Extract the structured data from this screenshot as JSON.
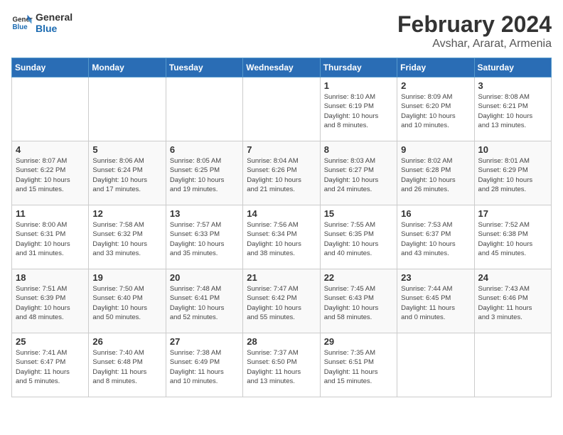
{
  "header": {
    "logo_line1": "General",
    "logo_line2": "Blue",
    "month": "February 2024",
    "location": "Avshar, Ararat, Armenia"
  },
  "days_of_week": [
    "Sunday",
    "Monday",
    "Tuesday",
    "Wednesday",
    "Thursday",
    "Friday",
    "Saturday"
  ],
  "weeks": [
    [
      {
        "day": "",
        "info": ""
      },
      {
        "day": "",
        "info": ""
      },
      {
        "day": "",
        "info": ""
      },
      {
        "day": "",
        "info": ""
      },
      {
        "day": "1",
        "info": "Sunrise: 8:10 AM\nSunset: 6:19 PM\nDaylight: 10 hours\nand 8 minutes."
      },
      {
        "day": "2",
        "info": "Sunrise: 8:09 AM\nSunset: 6:20 PM\nDaylight: 10 hours\nand 10 minutes."
      },
      {
        "day": "3",
        "info": "Sunrise: 8:08 AM\nSunset: 6:21 PM\nDaylight: 10 hours\nand 13 minutes."
      }
    ],
    [
      {
        "day": "4",
        "info": "Sunrise: 8:07 AM\nSunset: 6:22 PM\nDaylight: 10 hours\nand 15 minutes."
      },
      {
        "day": "5",
        "info": "Sunrise: 8:06 AM\nSunset: 6:24 PM\nDaylight: 10 hours\nand 17 minutes."
      },
      {
        "day": "6",
        "info": "Sunrise: 8:05 AM\nSunset: 6:25 PM\nDaylight: 10 hours\nand 19 minutes."
      },
      {
        "day": "7",
        "info": "Sunrise: 8:04 AM\nSunset: 6:26 PM\nDaylight: 10 hours\nand 21 minutes."
      },
      {
        "day": "8",
        "info": "Sunrise: 8:03 AM\nSunset: 6:27 PM\nDaylight: 10 hours\nand 24 minutes."
      },
      {
        "day": "9",
        "info": "Sunrise: 8:02 AM\nSunset: 6:28 PM\nDaylight: 10 hours\nand 26 minutes."
      },
      {
        "day": "10",
        "info": "Sunrise: 8:01 AM\nSunset: 6:29 PM\nDaylight: 10 hours\nand 28 minutes."
      }
    ],
    [
      {
        "day": "11",
        "info": "Sunrise: 8:00 AM\nSunset: 6:31 PM\nDaylight: 10 hours\nand 31 minutes."
      },
      {
        "day": "12",
        "info": "Sunrise: 7:58 AM\nSunset: 6:32 PM\nDaylight: 10 hours\nand 33 minutes."
      },
      {
        "day": "13",
        "info": "Sunrise: 7:57 AM\nSunset: 6:33 PM\nDaylight: 10 hours\nand 35 minutes."
      },
      {
        "day": "14",
        "info": "Sunrise: 7:56 AM\nSunset: 6:34 PM\nDaylight: 10 hours\nand 38 minutes."
      },
      {
        "day": "15",
        "info": "Sunrise: 7:55 AM\nSunset: 6:35 PM\nDaylight: 10 hours\nand 40 minutes."
      },
      {
        "day": "16",
        "info": "Sunrise: 7:53 AM\nSunset: 6:37 PM\nDaylight: 10 hours\nand 43 minutes."
      },
      {
        "day": "17",
        "info": "Sunrise: 7:52 AM\nSunset: 6:38 PM\nDaylight: 10 hours\nand 45 minutes."
      }
    ],
    [
      {
        "day": "18",
        "info": "Sunrise: 7:51 AM\nSunset: 6:39 PM\nDaylight: 10 hours\nand 48 minutes."
      },
      {
        "day": "19",
        "info": "Sunrise: 7:50 AM\nSunset: 6:40 PM\nDaylight: 10 hours\nand 50 minutes."
      },
      {
        "day": "20",
        "info": "Sunrise: 7:48 AM\nSunset: 6:41 PM\nDaylight: 10 hours\nand 52 minutes."
      },
      {
        "day": "21",
        "info": "Sunrise: 7:47 AM\nSunset: 6:42 PM\nDaylight: 10 hours\nand 55 minutes."
      },
      {
        "day": "22",
        "info": "Sunrise: 7:45 AM\nSunset: 6:43 PM\nDaylight: 10 hours\nand 58 minutes."
      },
      {
        "day": "23",
        "info": "Sunrise: 7:44 AM\nSunset: 6:45 PM\nDaylight: 11 hours\nand 0 minutes."
      },
      {
        "day": "24",
        "info": "Sunrise: 7:43 AM\nSunset: 6:46 PM\nDaylight: 11 hours\nand 3 minutes."
      }
    ],
    [
      {
        "day": "25",
        "info": "Sunrise: 7:41 AM\nSunset: 6:47 PM\nDaylight: 11 hours\nand 5 minutes."
      },
      {
        "day": "26",
        "info": "Sunrise: 7:40 AM\nSunset: 6:48 PM\nDaylight: 11 hours\nand 8 minutes."
      },
      {
        "day": "27",
        "info": "Sunrise: 7:38 AM\nSunset: 6:49 PM\nDaylight: 11 hours\nand 10 minutes."
      },
      {
        "day": "28",
        "info": "Sunrise: 7:37 AM\nSunset: 6:50 PM\nDaylight: 11 hours\nand 13 minutes."
      },
      {
        "day": "29",
        "info": "Sunrise: 7:35 AM\nSunset: 6:51 PM\nDaylight: 11 hours\nand 15 minutes."
      },
      {
        "day": "",
        "info": ""
      },
      {
        "day": "",
        "info": ""
      }
    ]
  ]
}
